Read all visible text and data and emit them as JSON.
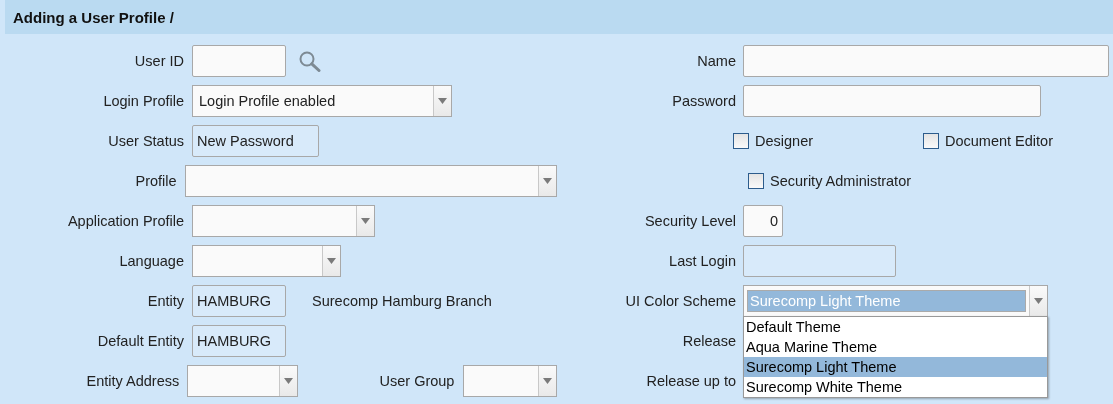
{
  "header": {
    "title": "Adding a User Profile /"
  },
  "rows": [
    {
      "left": {
        "label": "User ID",
        "kind": "lookup"
      },
      "right": {
        "label": "Name",
        "kind": "text"
      }
    },
    {
      "left": {
        "label": "Login Profile",
        "kind": "combo",
        "value": "Login Profile enabled"
      },
      "right": {
        "label": "Password",
        "kind": "text"
      }
    },
    {
      "left": {
        "label": "User Status",
        "kind": "readonly",
        "value": "New Password"
      },
      "right": {
        "kind": "checkboxes",
        "items": [
          {
            "label": "Designer",
            "checked": false
          },
          {
            "label": "Document Editor",
            "checked": false
          }
        ]
      }
    },
    {
      "left": {
        "label": "Profile",
        "kind": "combo"
      },
      "right": {
        "kind": "checkboxes",
        "items": [
          {
            "label": "Security Administrator",
            "checked": false
          }
        ]
      }
    },
    {
      "left": {
        "label": "Application Profile",
        "kind": "combo"
      },
      "right": {
        "label": "Security Level",
        "kind": "number",
        "value": "0"
      }
    },
    {
      "left": {
        "label": "Language",
        "kind": "combo"
      },
      "right": {
        "label": "Last Login",
        "kind": "readonly"
      }
    },
    {
      "left": {
        "label": "Entity",
        "kind": "readonly",
        "value": "HAMBURG",
        "note": "Surecomp Hamburg Branch"
      },
      "right": {
        "label": "UI Color Scheme",
        "kind": "combo",
        "value": "Surecomp Light Theme",
        "expanded": true,
        "options": [
          {
            "label": "Default Theme",
            "selected": false
          },
          {
            "label": "Aqua Marine Theme",
            "selected": false
          },
          {
            "label": "Surecomp Light Theme",
            "selected": true
          },
          {
            "label": "Surecomp White Theme",
            "selected": false
          }
        ]
      }
    },
    {
      "left": {
        "label": "Default Entity",
        "kind": "readonly",
        "value": "HAMBURG"
      },
      "right": {
        "label": "Release",
        "kind": "covered"
      }
    },
    {
      "left": {
        "label": "Entity Address",
        "kind": "combo"
      },
      "middle": {
        "label": "User Group",
        "kind": "combo"
      },
      "right": {
        "label": "Release up to",
        "kind": "covered"
      }
    }
  ]
}
